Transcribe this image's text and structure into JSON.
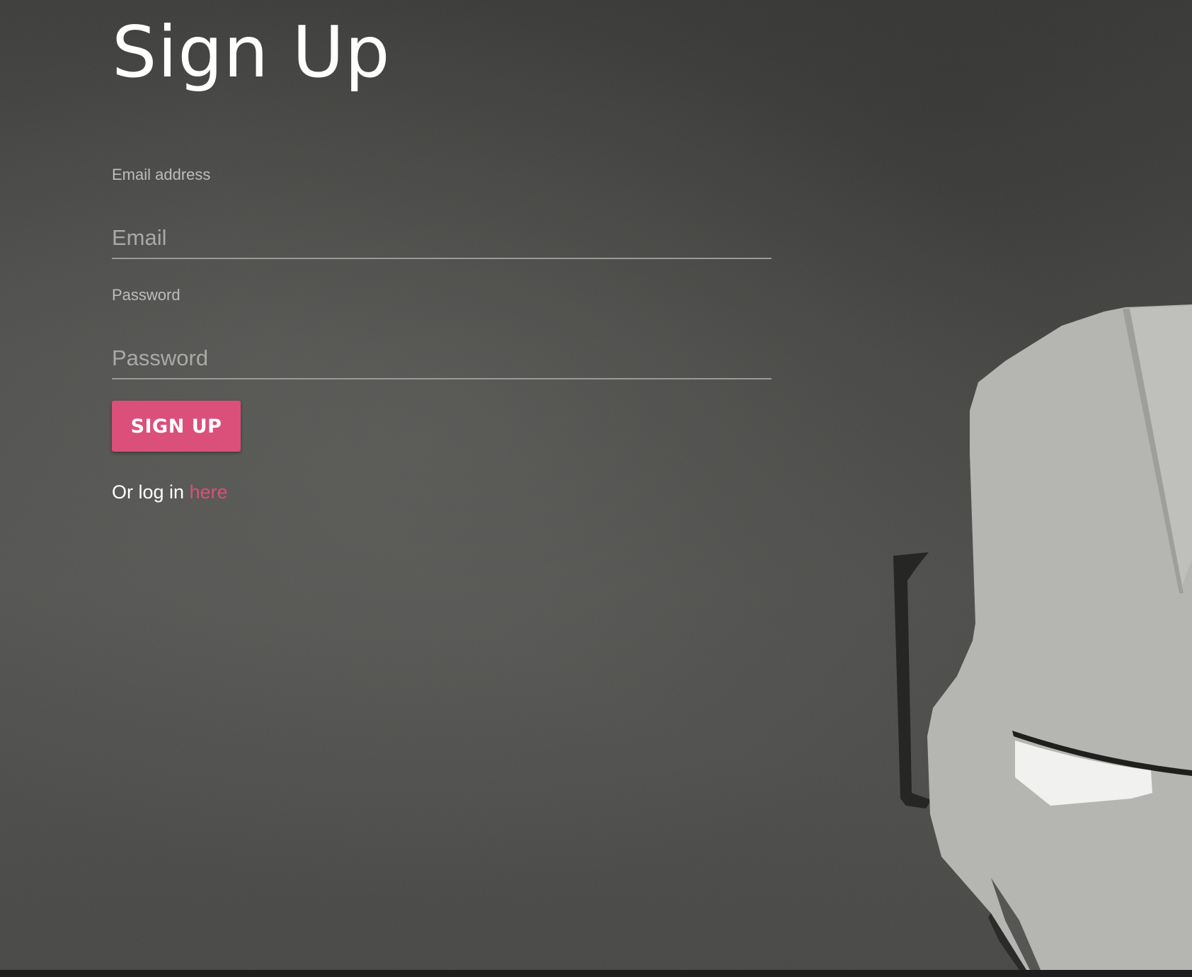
{
  "page": {
    "title": "Sign Up"
  },
  "form": {
    "email": {
      "label": "Email address",
      "placeholder": "Email",
      "value": ""
    },
    "password": {
      "label": "Password",
      "placeholder": "Password",
      "value": ""
    },
    "submit_label": "SIGN UP"
  },
  "login": {
    "prefix": "Or log in",
    "link_text": "here"
  },
  "colors": {
    "accent": "#db4f7b",
    "background": "#4a4a48",
    "text": "#ffffff",
    "muted_text": "#bdbdbb"
  },
  "icons": {
    "background_art": "iron-man-helmet-illustration"
  }
}
